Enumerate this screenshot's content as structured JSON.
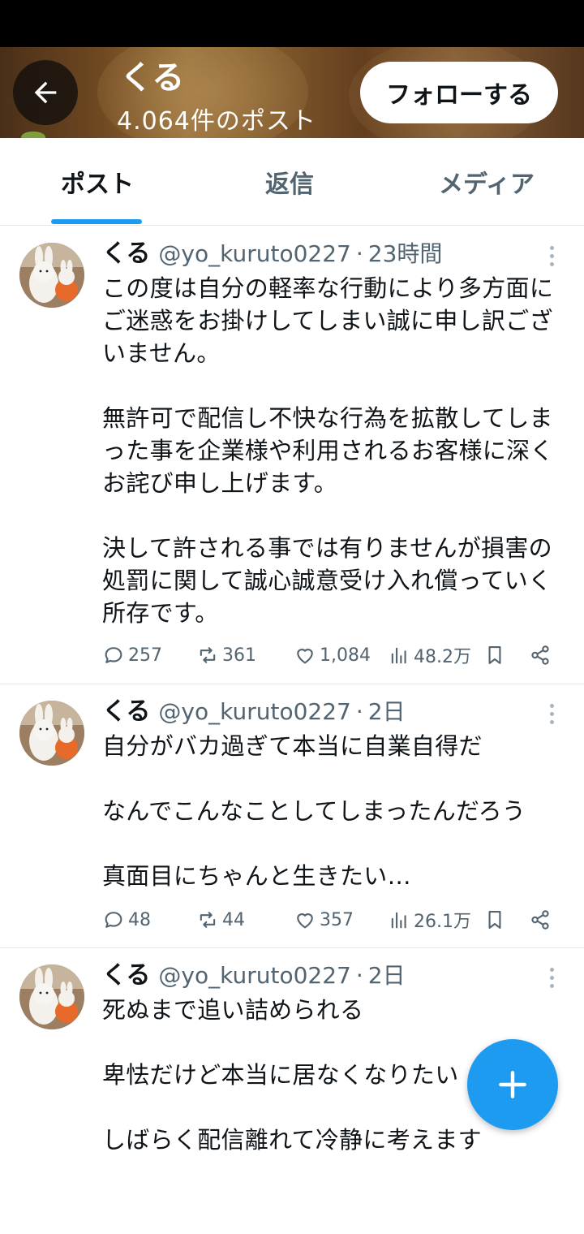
{
  "header": {
    "name": "くる",
    "post_count": "4.064件のポスト",
    "follow_label": "フォローする"
  },
  "tabs": [
    {
      "label": "ポスト",
      "active": true
    },
    {
      "label": "返信",
      "active": false
    },
    {
      "label": "メディア",
      "active": false
    }
  ],
  "posts": [
    {
      "name": "くる",
      "handle": "@yo_kuruto0227",
      "sep": "·",
      "time": "23時間",
      "lines": [
        "この度は自分の軽率な行動により多方面に",
        "ご迷惑をお掛けしてしまい誠に申し訳ござ",
        "いません。",
        "",
        "無許可で配信し不快な行為を拡散してしま",
        "った事を企業様や利用されるお客様に深く",
        "お詫び申し上げます。",
        "",
        "決して許される事では有りませんが損害の",
        "処罰に関して誠心誠意受け入れ償っていく",
        "所存です。"
      ],
      "replies": "257",
      "reposts": "361",
      "likes": "1,084",
      "views": "48.2万"
    },
    {
      "name": "くる",
      "handle": "@yo_kuruto0227",
      "sep": "·",
      "time": "2日",
      "lines": [
        "自分がバカ過ぎて本当に自業自得だ",
        "",
        "なんでこんなことしてしまったんだろう",
        "",
        "真面目にちゃんと生きたい…"
      ],
      "replies": "48",
      "reposts": "44",
      "likes": "357",
      "views": "26.1万"
    },
    {
      "name": "くる",
      "handle": "@yo_kuruto0227",
      "sep": "·",
      "time": "2日",
      "lines": [
        "死ぬまで追い詰められる",
        "",
        "卑怯だけど本当に居なくなりたい",
        "",
        "しばらく配信離れて冷静に考えます"
      ]
    }
  ],
  "colors": {
    "accent": "#1d9bf0",
    "text": "#0f1419",
    "muted": "#536471"
  },
  "icons": [
    "back-arrow-icon",
    "more-icon",
    "reply-icon",
    "repost-icon",
    "like-icon",
    "views-icon",
    "bookmark-icon",
    "share-icon",
    "compose-plus-icon"
  ]
}
